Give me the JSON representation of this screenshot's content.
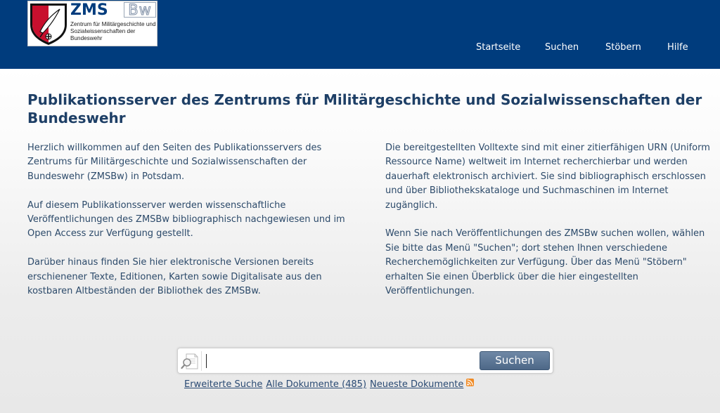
{
  "header": {
    "logo": {
      "brand": "ZMS",
      "brand_suffix": "Bw",
      "subtitle": "Zentrum für Militärgeschichte und Sozialwissenschaften der Bundeswehr"
    },
    "nav": [
      {
        "label": "Startseite"
      },
      {
        "label": "Suchen"
      },
      {
        "label": "Stöbern"
      },
      {
        "label": "Hilfe"
      }
    ]
  },
  "main": {
    "title": "Publikationsserver des Zentrums für Militärgeschichte und Sozialwissenschaften der Bundeswehr",
    "left_paragraphs": [
      "Herzlich willkommen auf den Seiten des Publikationsservers des Zentrums für Militärgeschichte und Sozialwissenschaften der Bundeswehr (ZMSBw) in Potsdam.",
      "Auf diesem Publikationsserver werden wissenschaftliche Veröffentlichungen des ZMSBw bibliographisch nachgewiesen und im Open Access zur Verfügung gestellt.",
      "Darüber hinaus finden Sie hier elektronische Versionen bereits erschienener Texte, Editionen, Karten sowie Digitalisate aus den kostbaren Altbeständen der Bibliothek des ZMSBw."
    ],
    "right_paragraphs": [
      "Die bereitgestellten Volltexte sind mit einer zitierfähigen URN (Uniform Ressource Name) weltweit im Internet recherchierbar und werden dauerhaft elektronisch archiviert. Sie sind bibliographisch erschlossen und über Bibliothekskataloge und Suchmaschinen im Internet zugänglich.",
      "Wenn Sie nach Veröffentlichungen des ZMSBw suchen wollen, wählen Sie bitte das Menü \"Suchen\"; dort stehen Ihnen verschiedene Recherchemöglichkeiten zur Verfügung. Über das Menü \"Stöbern\" erhalten Sie einen Überblick über die hier eingestellten Veröffentlichungen."
    ]
  },
  "search": {
    "value": "",
    "button_label": "Suchen"
  },
  "links": {
    "advanced": "Erweiterte Suche",
    "all_documents": "Alle Dokumente (485)",
    "newest": "Neueste Dokumente"
  },
  "icons": {
    "search": "magnifier-document-icon",
    "rss": "rss-feed-icon"
  },
  "colors": {
    "header_bg": "#003c7d",
    "title_text": "#1e3f66",
    "body_text": "#2c4a6a",
    "button_bg": "#5b7594",
    "rss": "#f08a24"
  }
}
